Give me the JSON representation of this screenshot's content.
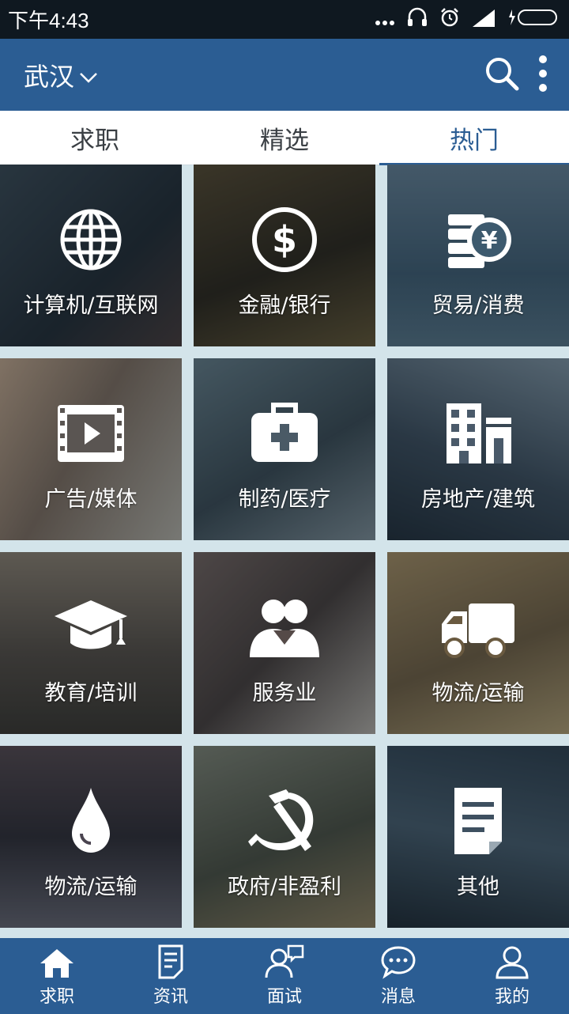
{
  "status_bar": {
    "time": "下午4:43"
  },
  "app_bar": {
    "city": "武汉"
  },
  "tabs": [
    {
      "label": "求职"
    },
    {
      "label": "精选"
    },
    {
      "label": "热门",
      "active": true
    }
  ],
  "categories": [
    {
      "label": "计算机/互联网",
      "icon": "globe-icon"
    },
    {
      "label": "金融/银行",
      "icon": "dollar-coin-icon"
    },
    {
      "label": "贸易/消费",
      "icon": "yen-coins-icon"
    },
    {
      "label": "广告/媒体",
      "icon": "video-film-icon"
    },
    {
      "label": "制药/医疗",
      "icon": "medical-kit-icon"
    },
    {
      "label": "房地产/建筑",
      "icon": "buildings-icon"
    },
    {
      "label": "教育/培训",
      "icon": "graduation-cap-icon"
    },
    {
      "label": "服务业",
      "icon": "people-icon"
    },
    {
      "label": "物流/运输",
      "icon": "truck-icon"
    },
    {
      "label": "物流/运输",
      "icon": "water-drop-icon"
    },
    {
      "label": "政府/非盈利",
      "icon": "hammer-sickle-icon"
    },
    {
      "label": "其他",
      "icon": "document-icon"
    }
  ],
  "bottom_nav": [
    {
      "label": "求职",
      "icon": "home-icon"
    },
    {
      "label": "资讯",
      "icon": "news-icon"
    },
    {
      "label": "面试",
      "icon": "interview-icon"
    },
    {
      "label": "消息",
      "icon": "message-icon"
    },
    {
      "label": "我的",
      "icon": "profile-icon"
    }
  ],
  "colors": {
    "primary": "#2b5d93",
    "background": "#d3e4ea",
    "status_bar": "#0f1820"
  }
}
